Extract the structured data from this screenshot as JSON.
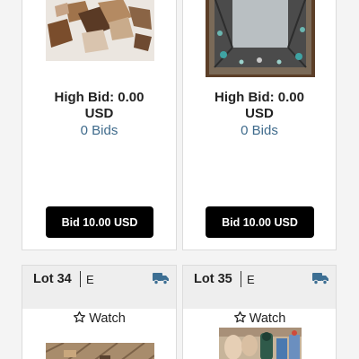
{
  "cards": [
    {
      "high_bid": "High Bid: 0.00",
      "currency": "USD",
      "bids": "0 Bids",
      "bid_button": "Bid 10.00 USD"
    },
    {
      "high_bid": "High Bid: 0.00",
      "currency": "USD",
      "bids": "0 Bids",
      "bid_button": "Bid 10.00 USD"
    }
  ],
  "lots": [
    {
      "lot_label": "Lot 34",
      "lot_code": "E",
      "watch_label": "Watch",
      "shipping_icon": "truck-icon"
    },
    {
      "lot_label": "Lot 35",
      "lot_code": "E",
      "watch_label": "Watch",
      "shipping_icon": "truck-icon"
    }
  ],
  "colors": {
    "button_bg": "#000000",
    "bids_link": "#3f6b8c",
    "truck_icon": "#3d6f93",
    "lot_header_bg": "#eeeeee"
  }
}
